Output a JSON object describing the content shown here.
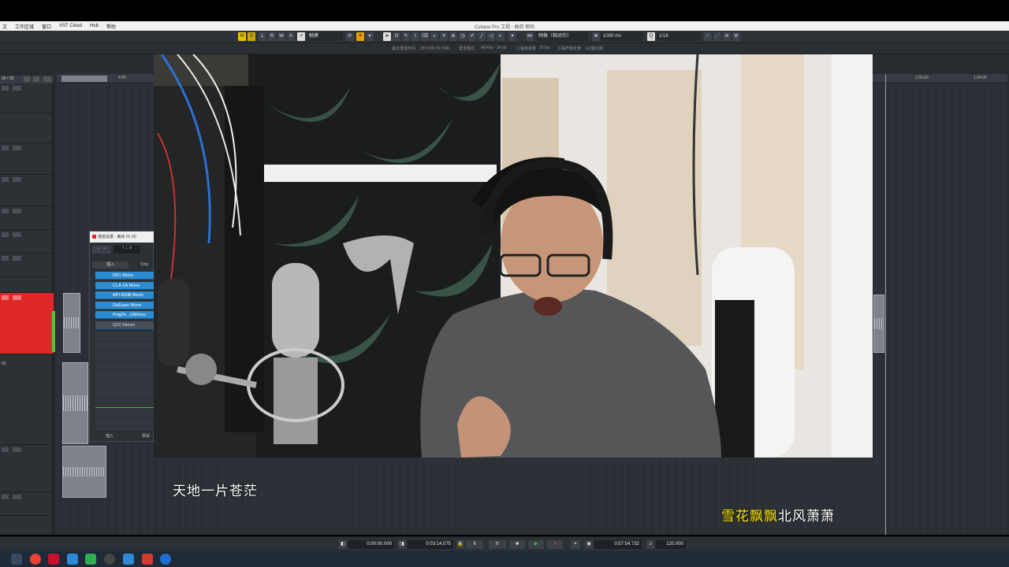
{
  "menubar": {
    "items": [
      "文",
      "工作区域",
      "窗口",
      "VST Cloud",
      "Hub",
      "帮助"
    ],
    "window_title": "Cubase Pro 工程 - 曲目 密码"
  },
  "toolbar": {
    "mode_buttons": [
      "M",
      "S",
      "L",
      "R",
      "W",
      "A"
    ],
    "touch_mode": "触摸",
    "grid_mode": "网格（相对的）",
    "nudge": "1000 ms",
    "quantize": "1/16"
  },
  "infostrip": {
    "items": [
      "最大录音时间",
      "297小时 30 分钟",
      "录音格式",
      "48 kHz - 24 bit",
      "工程帧速率",
      "30 fps",
      "工程声像定律",
      "EQ整过频"
    ]
  },
  "ruler": {
    "left_counter": "39 / 39",
    "labels": [
      "4:00",
      "1:00:00",
      "1:04:00"
    ]
  },
  "tracklist": {
    "track_label": "01"
  },
  "mixer": {
    "title": "通道设置 - 曲目 01 (0)",
    "tab_inserts": "插入",
    "tab_strip": "Strip",
    "inserts": [
      "NS1 Mono",
      "CLA-2A Mono",
      "API-550B Mono",
      "DeEsser Mono",
      "PuigTe...1AMono",
      "Q10 Stereo"
    ],
    "footer_left": "插入",
    "footer_right": "预设"
  },
  "subtitles": {
    "left": "天地一片苍茫",
    "right_highlight": "雪花飘飘",
    "right_rest": "北风萧萧"
  },
  "transport": {
    "position_start": "0:00:00.000",
    "position_main": "0:03:14.075",
    "position_secondary": "0:57:54.732",
    "tempo": "120.000"
  },
  "colors": {
    "accent_yellow": "#e8c200",
    "insert_blue": "#2d8bd0",
    "record_red": "#d83030",
    "play_green": "#3cc23c",
    "subtitle_highlight": "#ffe600",
    "track_red": "#e02828"
  },
  "taskbar": {
    "icons": [
      "start-icon",
      "task-view-icon",
      "chrome-icon",
      "cubase-icon",
      "wechat-icon",
      "app-icon",
      "obs-icon",
      "cubase-alt-icon",
      "davinci-icon"
    ]
  }
}
